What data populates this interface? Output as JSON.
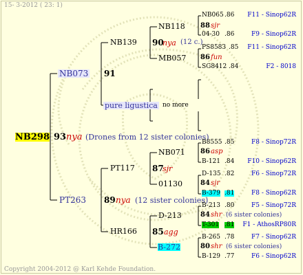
{
  "header": {
    "date_line": "15-  3-2012 ( 23:  1)"
  },
  "footer": {
    "copyright": "Copyright 2004-2012 @ Karl Kehde Foundation."
  },
  "colors": {
    "background": "#ffffe0",
    "root_highlight": "#ffff00",
    "cyan_highlight": "#00ffff",
    "green_highlight": "#00cc00",
    "link_blue": "#0000cc",
    "race_red": "#cc0000"
  },
  "root": {
    "id": "NB298",
    "year": "93",
    "race": "nya",
    "note": "(Drones from 12 sister colonies)"
  },
  "gen1": {
    "father": {
      "id": "NB073",
      "year": "91"
    },
    "mother": {
      "id": "PT263",
      "year": "89",
      "race": "nya",
      "note": "(12 sister colonies)"
    }
  },
  "gen2": {
    "nb139": {
      "id": "NB139",
      "year": "90",
      "race": "nya",
      "note": "(12 c.)"
    },
    "pure": {
      "id": "pure ligustica",
      "note": "no more"
    },
    "pt117": {
      "id": "PT117",
      "year": "87",
      "race": "sjr"
    },
    "hr166": {
      "id": "HR166",
      "year": "85",
      "race": "agg"
    }
  },
  "gen3": {
    "nb118": {
      "id": "NB118",
      "year": "88",
      "race": "sjr"
    },
    "mb057": {
      "id": "MB057",
      "year": "86",
      "race": "fun"
    },
    "nb071": {
      "id": "NB071",
      "year": "86",
      "race": "asp"
    },
    "n01130": {
      "id": "01130",
      "year": "84",
      "race": "sjr"
    },
    "d213": {
      "id": "D-213",
      "year": "84",
      "race": "shr",
      "note": "(6 sister colonies)"
    },
    "b272": {
      "id": "B-272",
      "year": "80",
      "race": "shr",
      "note": "(6 sister colonies)"
    }
  },
  "gen4": [
    {
      "id": "NB065",
      "year": ".86",
      "loc": "F11 - Sinop62R"
    },
    {
      "id": "04-30",
      "year": ".86",
      "loc": "F9 - Sinop62R"
    },
    {
      "id": "PS8583",
      "year": ".85",
      "loc": "F11 - Sinop62R"
    },
    {
      "id": "SG8412",
      "year": ".84",
      "loc": "F2 - 8018"
    },
    {
      "id": "B8555",
      "year": ".85",
      "loc": "F8 - Sinop72R"
    },
    {
      "id": "B-121",
      "year": ".84",
      "loc": "F10 - Sinop62R"
    },
    {
      "id": "D-135",
      "year": ".82",
      "loc": "F6 - Sinop72R"
    },
    {
      "id": "B-379",
      "year": ".81",
      "loc": "F8 - Sinop62R"
    },
    {
      "id": "B-213",
      "year": ".80",
      "loc": "F5 - Sinop72R"
    },
    {
      "id": "T-301",
      "year": ".81",
      "loc": "F1 - AthosRP80R"
    },
    {
      "id": "B-265",
      "year": ".78",
      "loc": "F7 - Sinop62R"
    },
    {
      "id": "B-129",
      "year": ".77",
      "loc": "F6 - Sinop62R"
    }
  ]
}
